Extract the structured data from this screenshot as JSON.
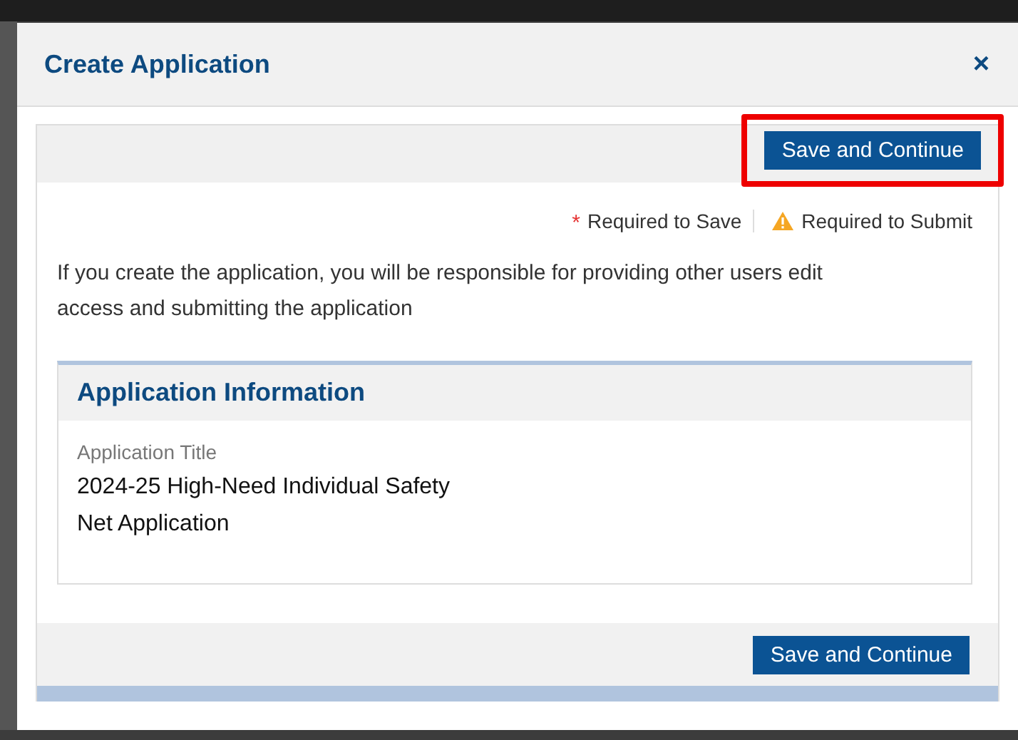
{
  "dialog": {
    "title": "Create Application",
    "close": "×"
  },
  "top_button": {
    "label": "Save and Continue",
    "highlighted": true
  },
  "legend": [
    {
      "kind": "asterisk",
      "mark": "*",
      "label": "Required to Save"
    },
    {
      "kind": "warning",
      "label": "Required to Submit"
    }
  ],
  "message": "If you create the application, you will be responsible for providing other users edit access and submitting the application",
  "section": {
    "title": "Application Information",
    "field_label": "Application Title",
    "field_value": "2024-25 High-Need Individual Safety Net Application"
  },
  "bottom_button": {
    "label": "Save and Continue",
    "highlighted": false
  }
}
